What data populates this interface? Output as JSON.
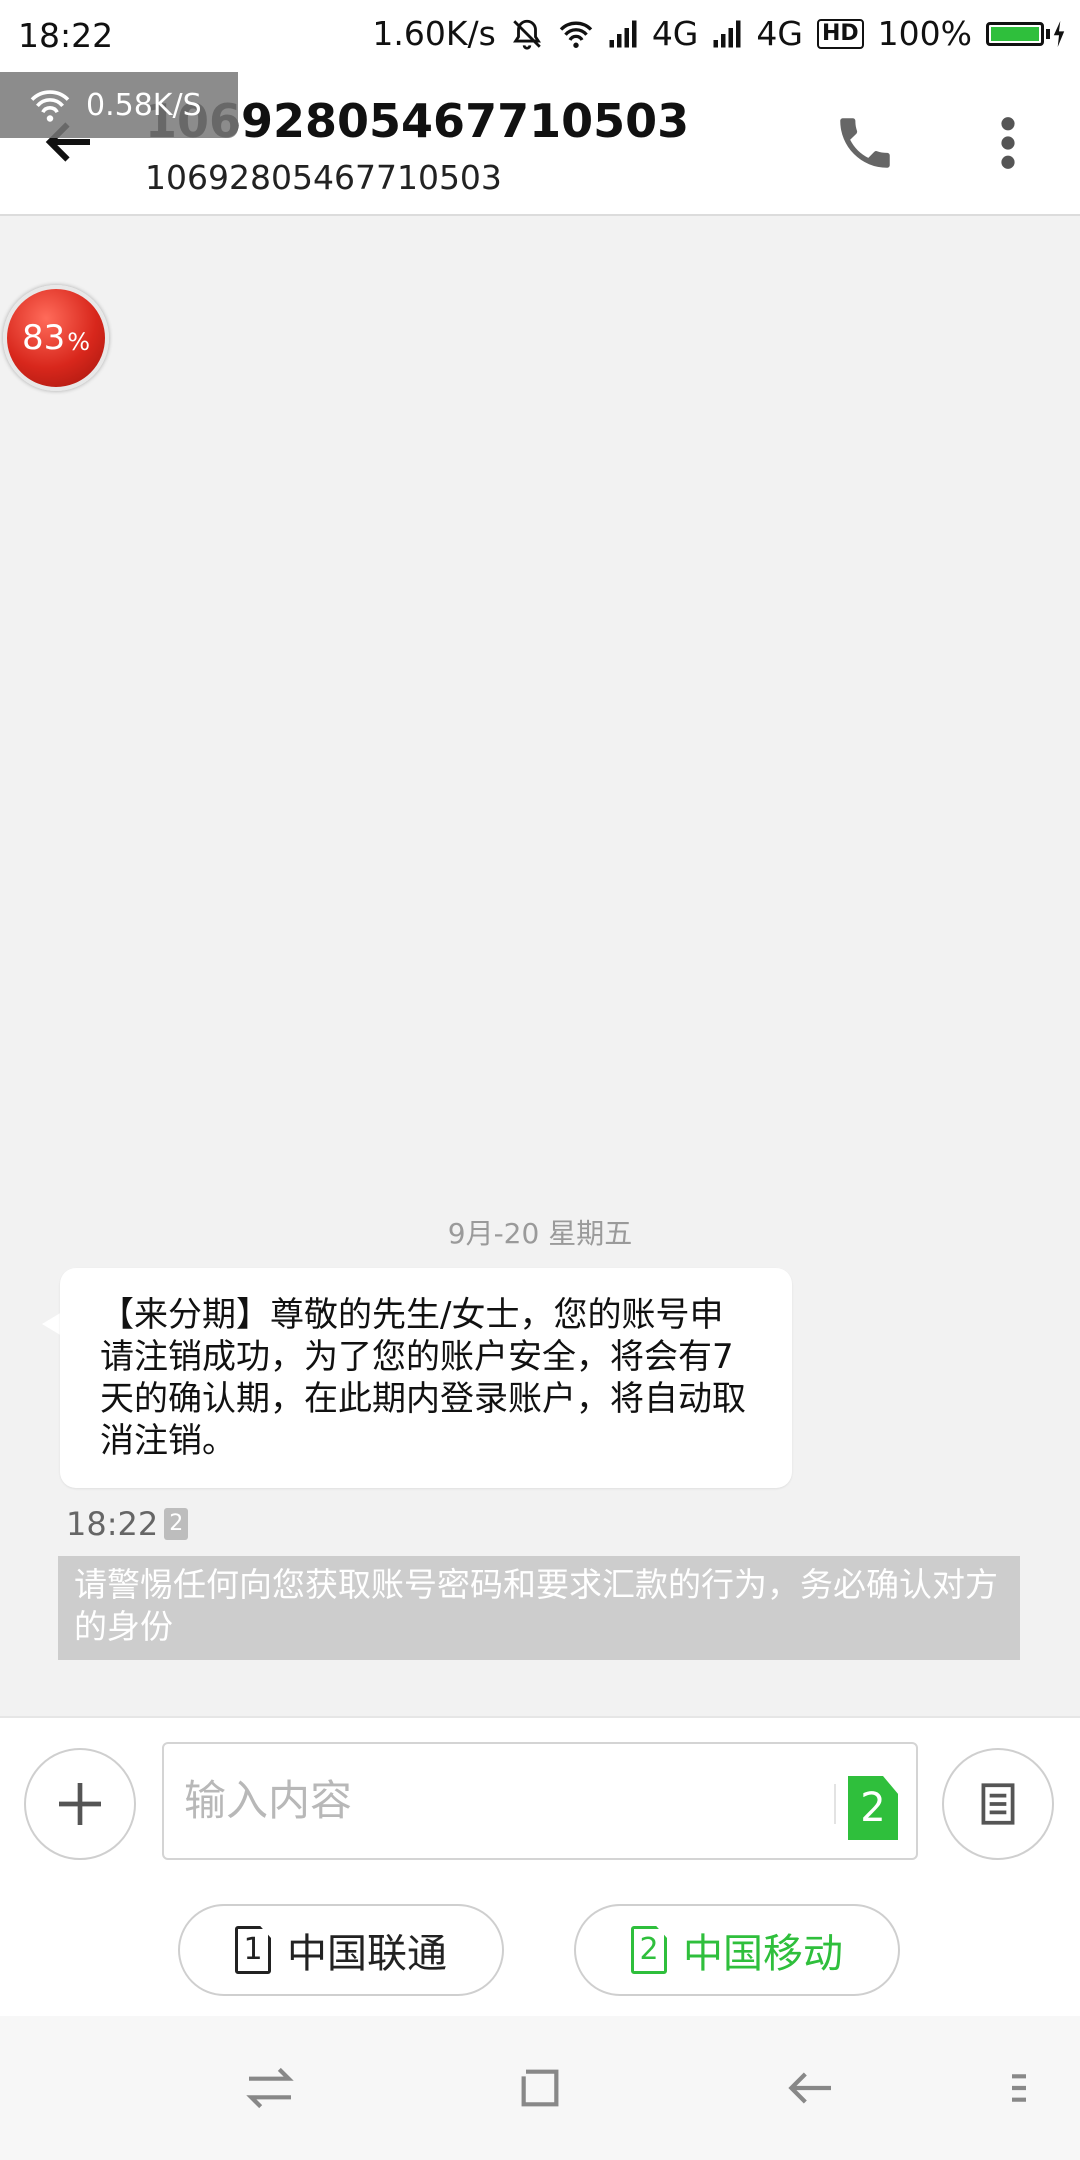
{
  "status_bar": {
    "time": "18:22",
    "net_speed": "1.60K/s",
    "network_1": "4G",
    "network_2": "4G",
    "hd": "HD",
    "battery": "100%",
    "battery_level": 1.0
  },
  "speed_overlay": {
    "text": "0.58K/S"
  },
  "percent_ball": {
    "value": "83",
    "unit": "%"
  },
  "header": {
    "title": "10692805467710503",
    "subtitle": "10692805467710503"
  },
  "conversation": {
    "date": "9月-20  星期五",
    "message": "【来分期】尊敬的先生/女士，您的账号申请注销成功，为了您的账户安全，将会有7天的确认期，在此期内登录账户，将自动取消注销。",
    "time": "18:22",
    "sim": "2",
    "warning": "请警惕任何向您获取账号密码和要求汇款的行为，务必确认对方的身份"
  },
  "input": {
    "placeholder": "输入内容",
    "sim_selected": "2"
  },
  "sim_buttons": [
    {
      "num": "1",
      "label": "中国联通"
    },
    {
      "num": "2",
      "label": "中国移动"
    }
  ],
  "colors": {
    "accent": "#2fbf3c",
    "alert_ball": "#d8271c"
  }
}
